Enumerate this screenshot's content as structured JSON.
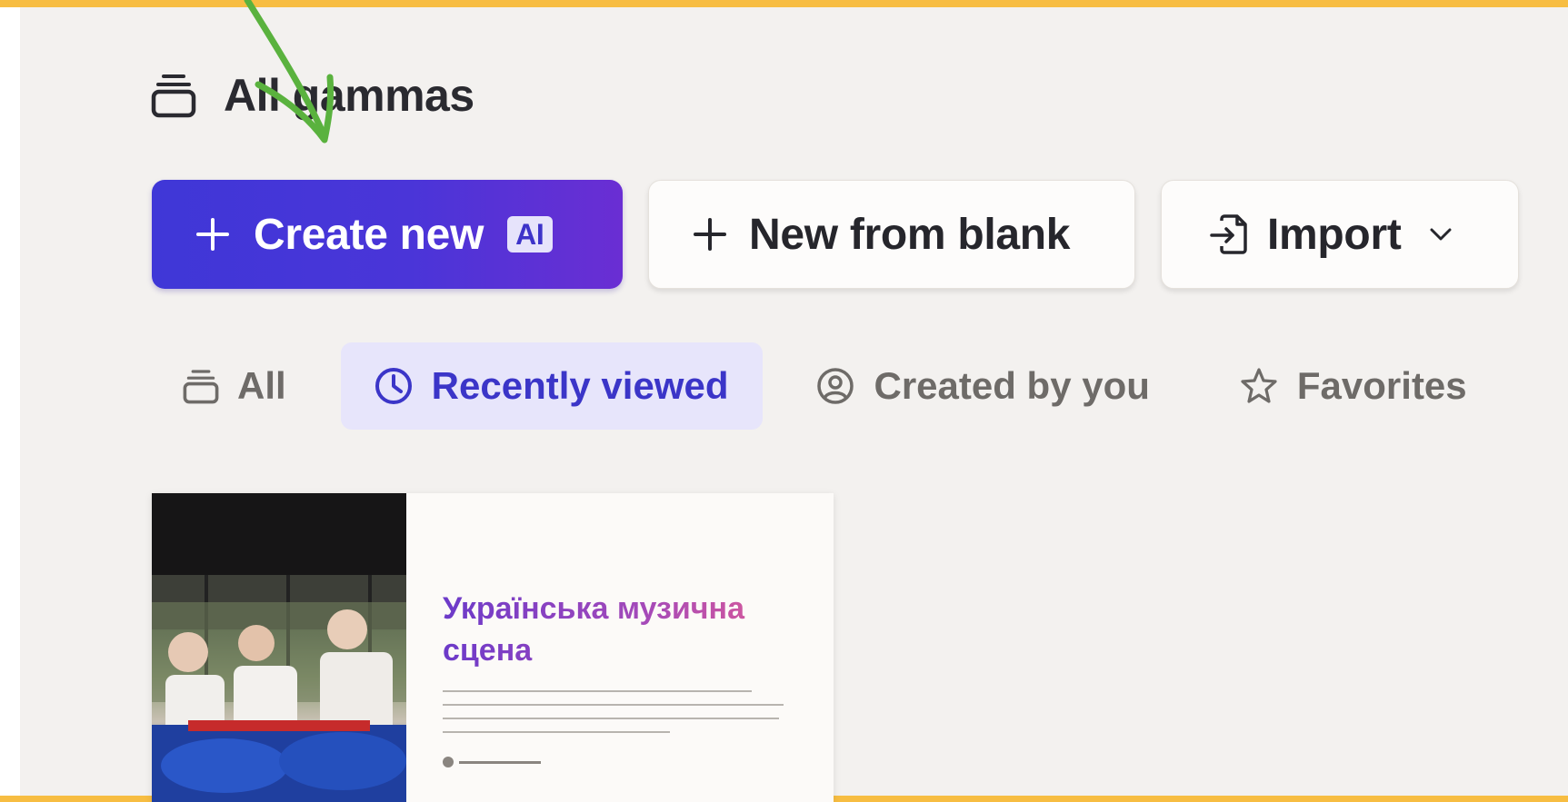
{
  "header": {
    "title": "All gammas",
    "icon": "stack-icon"
  },
  "actions": {
    "create_new": {
      "label": "Create new",
      "badge": "AI",
      "icon": "plus-icon"
    },
    "new_from_blank": {
      "label": "New from blank",
      "icon": "plus-icon"
    },
    "import": {
      "label": "Import",
      "icon": "import-icon",
      "caret": "chevron-down-icon"
    }
  },
  "tabs": [
    {
      "label": "All",
      "icon": "stack-icon",
      "active": false
    },
    {
      "label": "Recently viewed",
      "icon": "clock-icon",
      "active": true
    },
    {
      "label": "Created by you",
      "icon": "user-circle-icon",
      "active": false
    },
    {
      "label": "Favorites",
      "icon": "star-icon",
      "active": false
    }
  ],
  "cards": [
    {
      "title": "Українська музична сцена",
      "image": "photo of dancers in traditional Ukrainian costume"
    }
  ],
  "colors": {
    "accent": "#4a35d8",
    "tab_active_bg": "#e7e5fb",
    "tab_active_text": "#3b35c8",
    "frame": "#f7bd42",
    "annotation_arrow": "#5ab23e"
  }
}
